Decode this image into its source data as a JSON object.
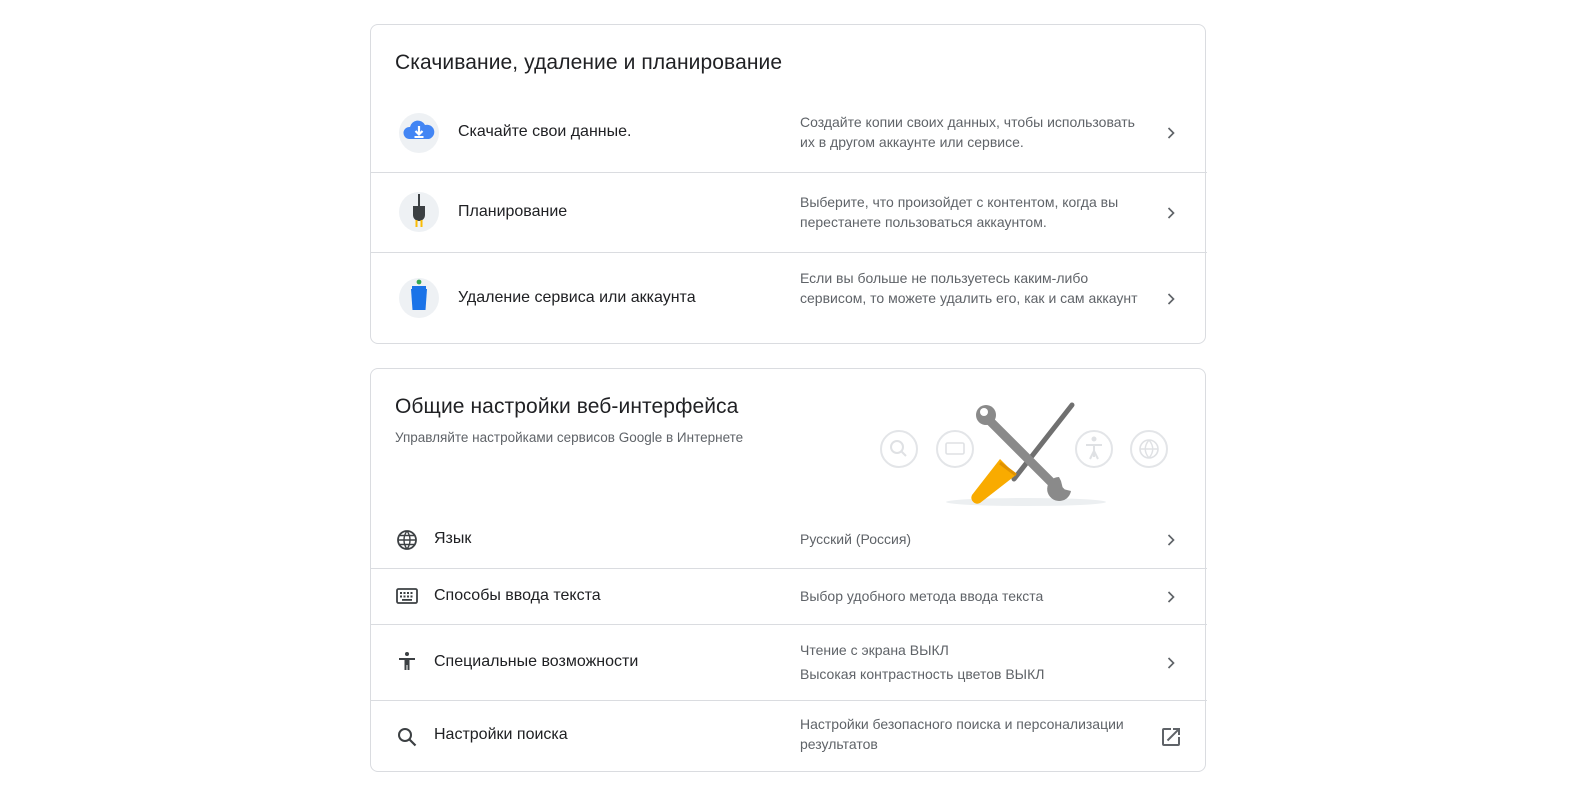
{
  "download_section": {
    "title": "Скачивание, удаление и планирование",
    "items": [
      {
        "label": "Скачайте свои данные.",
        "description": "Создайте копии своих данных, чтобы использовать их в другом аккаунте или сервисе.",
        "icon": "cloud-download-icon"
      },
      {
        "label": "Планирование",
        "description": "Выберите, что произойдет с контентом, когда вы перестанете пользоваться аккаунтом.",
        "icon": "plug-icon"
      },
      {
        "label": "Удаление сервиса или аккаунта",
        "description": "Если вы больше не пользуетесь каким-либо сервисом, то можете удалить его, как и сам аккаунт",
        "icon": "trash-bin-icon"
      }
    ]
  },
  "web_settings_section": {
    "title": "Общие настройки веб-интерфейса",
    "subtitle": "Управляйте настройками сервисов Google в Интернете",
    "items": [
      {
        "label": "Язык",
        "description": "Русский (Россия)",
        "icon": "globe-icon"
      },
      {
        "label": "Способы ввода текста",
        "description": "Выбор удобного метода ввода текста",
        "icon": "keyboard-icon"
      },
      {
        "label": "Специальные возможности",
        "description_line1": "Чтение с экрана ВЫКЛ",
        "description_line2": "Высокая контрастность цветов ВЫКЛ",
        "icon": "accessibility-icon"
      },
      {
        "label": "Настройки поиска",
        "description": "Настройки безопасного поиска и персонализации результатов",
        "icon": "search-icon",
        "action_icon": "open-in-new-icon"
      }
    ]
  },
  "colors": {
    "border": "#dadce0",
    "text_primary": "#202124",
    "text_secondary": "#5f6368",
    "accent_blue": "#4285f4",
    "accent_yellow": "#fbbc04"
  }
}
